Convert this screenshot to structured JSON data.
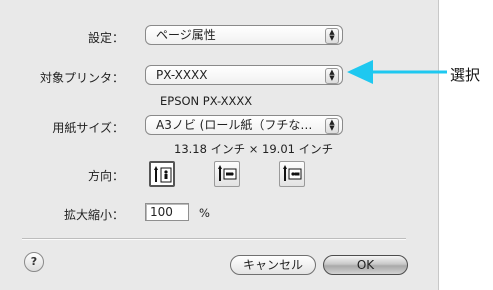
{
  "dialog": {
    "settings_label": "設定：",
    "settings_value": "ページ属性",
    "printer_label": "対象プリンタ：",
    "printer_value": "PX-XXXX",
    "printer_desc": "EPSON PX-XXXX",
    "paper_label": "用紙サイズ：",
    "paper_value": "A3ノビ (ロール紙（フチな…",
    "paper_dims": "13.18 インチ × 19.01 インチ",
    "orientation_label": "方向：",
    "scale_label": "拡大縮小：",
    "scale_value": "100",
    "scale_unit": "%",
    "help_label": "?",
    "cancel_label": "キャンセル",
    "ok_label": "OK"
  },
  "annotation": {
    "label": "選択",
    "arrow_color": "#1ec8f0"
  }
}
